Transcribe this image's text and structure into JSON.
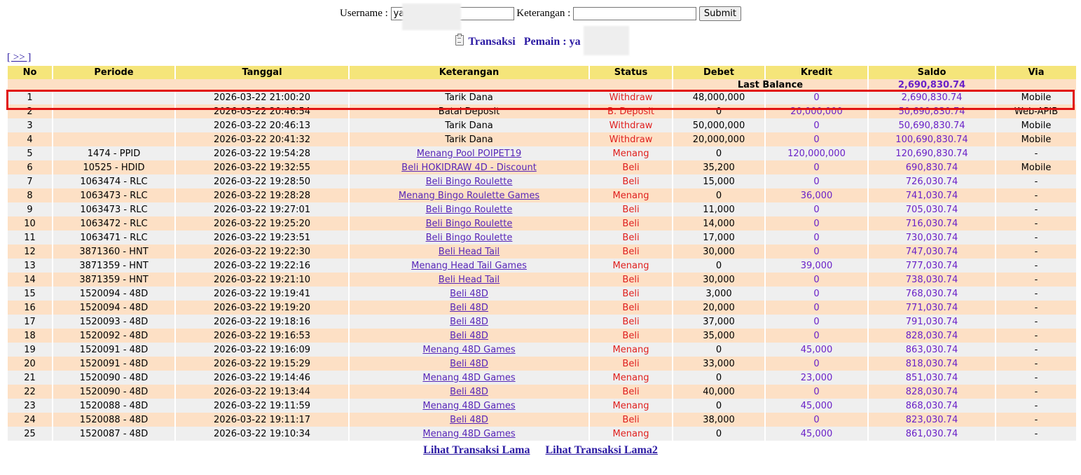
{
  "search": {
    "username_label": "Username :",
    "username_value": "ya",
    "keterangan_label": "Keterangan :",
    "keterangan_value": "",
    "submit_label": "Submit"
  },
  "heading": {
    "title": "Transaksi",
    "player_label": "Pemain : ya"
  },
  "nav": {
    "next_label": "[ >> ]"
  },
  "table": {
    "headers": [
      "No",
      "Periode",
      "Tanggal",
      "Keterangan",
      "Status",
      "Debet",
      "Kredit",
      "Saldo",
      "Via"
    ],
    "last_balance_label": "Last Balance",
    "last_balance_value": "2,690,830.74",
    "rows": [
      {
        "no": "1",
        "periode": "",
        "tanggal": "2026-03-22 21:00:20",
        "keterangan": "Tarik Dana",
        "link": false,
        "status": "Withdraw",
        "debet": "48,000,000",
        "kredit": "0",
        "saldo": "2,690,830.74",
        "via": "Mobile"
      },
      {
        "no": "2",
        "periode": "",
        "tanggal": "2026-03-22 20:46:54",
        "keterangan": "Batal Deposit",
        "link": false,
        "status": "B. Deposit",
        "debet": "0",
        "kredit": "20,000,000",
        "saldo": "50,690,830.74",
        "via": "Web-APIB"
      },
      {
        "no": "3",
        "periode": "",
        "tanggal": "2026-03-22 20:46:13",
        "keterangan": "Tarik Dana",
        "link": false,
        "status": "Withdraw",
        "debet": "50,000,000",
        "kredit": "0",
        "saldo": "50,690,830.74",
        "via": "Mobile"
      },
      {
        "no": "4",
        "periode": "",
        "tanggal": "2026-03-22 20:41:32",
        "keterangan": "Tarik Dana",
        "link": false,
        "status": "Withdraw",
        "debet": "20,000,000",
        "kredit": "0",
        "saldo": "100,690,830.74",
        "via": "Mobile"
      },
      {
        "no": "5",
        "periode": "1474 - PPID",
        "tanggal": "2026-03-22 19:54:28",
        "keterangan": "Menang Pool POIPET19",
        "link": true,
        "status": "Menang",
        "debet": "0",
        "kredit": "120,000,000",
        "saldo": "120,690,830.74",
        "via": "-"
      },
      {
        "no": "6",
        "periode": "10525 - HDID",
        "tanggal": "2026-03-22 19:32:55",
        "keterangan": "Beli HOKIDRAW 4D - Discount",
        "link": true,
        "status": "Beli",
        "debet": "35,200",
        "kredit": "0",
        "saldo": "690,830.74",
        "via": "Mobile"
      },
      {
        "no": "7",
        "periode": "1063474 - RLC",
        "tanggal": "2026-03-22 19:28:50",
        "keterangan": "Beli Bingo Roulette",
        "link": true,
        "status": "Beli",
        "debet": "15,000",
        "kredit": "0",
        "saldo": "726,030.74",
        "via": "-"
      },
      {
        "no": "8",
        "periode": "1063473 - RLC",
        "tanggal": "2026-03-22 19:28:28",
        "keterangan": "Menang Bingo Roulette Games",
        "link": true,
        "status": "Menang",
        "debet": "0",
        "kredit": "36,000",
        "saldo": "741,030.74",
        "via": "-"
      },
      {
        "no": "9",
        "periode": "1063473 - RLC",
        "tanggal": "2026-03-22 19:27:01",
        "keterangan": "Beli Bingo Roulette",
        "link": true,
        "status": "Beli",
        "debet": "11,000",
        "kredit": "0",
        "saldo": "705,030.74",
        "via": "-"
      },
      {
        "no": "10",
        "periode": "1063472 - RLC",
        "tanggal": "2026-03-22 19:25:20",
        "keterangan": "Beli Bingo Roulette",
        "link": true,
        "status": "Beli",
        "debet": "14,000",
        "kredit": "0",
        "saldo": "716,030.74",
        "via": "-"
      },
      {
        "no": "11",
        "periode": "1063471 - RLC",
        "tanggal": "2026-03-22 19:23:51",
        "keterangan": "Beli Bingo Roulette",
        "link": true,
        "status": "Beli",
        "debet": "17,000",
        "kredit": "0",
        "saldo": "730,030.74",
        "via": "-"
      },
      {
        "no": "12",
        "periode": "3871360 - HNT",
        "tanggal": "2026-03-22 19:22:30",
        "keterangan": "Beli Head Tail",
        "link": true,
        "status": "Beli",
        "debet": "30,000",
        "kredit": "0",
        "saldo": "747,030.74",
        "via": "-"
      },
      {
        "no": "13",
        "periode": "3871359 - HNT",
        "tanggal": "2026-03-22 19:22:16",
        "keterangan": "Menang Head Tail Games",
        "link": true,
        "status": "Menang",
        "debet": "0",
        "kredit": "39,000",
        "saldo": "777,030.74",
        "via": "-"
      },
      {
        "no": "14",
        "periode": "3871359 - HNT",
        "tanggal": "2026-03-22 19:21:10",
        "keterangan": "Beli Head Tail",
        "link": true,
        "status": "Beli",
        "debet": "30,000",
        "kredit": "0",
        "saldo": "738,030.74",
        "via": "-"
      },
      {
        "no": "15",
        "periode": "1520094 - 48D",
        "tanggal": "2026-03-22 19:19:41",
        "keterangan": "Beli 48D",
        "link": true,
        "status": "Beli",
        "debet": "3,000",
        "kredit": "0",
        "saldo": "768,030.74",
        "via": "-"
      },
      {
        "no": "16",
        "periode": "1520094 - 48D",
        "tanggal": "2026-03-22 19:19:20",
        "keterangan": "Beli 48D",
        "link": true,
        "status": "Beli",
        "debet": "20,000",
        "kredit": "0",
        "saldo": "771,030.74",
        "via": "-"
      },
      {
        "no": "17",
        "periode": "1520093 - 48D",
        "tanggal": "2026-03-22 19:18:16",
        "keterangan": "Beli 48D",
        "link": true,
        "status": "Beli",
        "debet": "37,000",
        "kredit": "0",
        "saldo": "791,030.74",
        "via": "-"
      },
      {
        "no": "18",
        "periode": "1520092 - 48D",
        "tanggal": "2026-03-22 19:16:53",
        "keterangan": "Beli 48D",
        "link": true,
        "status": "Beli",
        "debet": "35,000",
        "kredit": "0",
        "saldo": "828,030.74",
        "via": "-"
      },
      {
        "no": "19",
        "periode": "1520091 - 48D",
        "tanggal": "2026-03-22 19:16:09",
        "keterangan": "Menang 48D Games",
        "link": true,
        "status": "Menang",
        "debet": "0",
        "kredit": "45,000",
        "saldo": "863,030.74",
        "via": "-"
      },
      {
        "no": "20",
        "periode": "1520091 - 48D",
        "tanggal": "2026-03-22 19:15:29",
        "keterangan": "Beli 48D",
        "link": true,
        "status": "Beli",
        "debet": "33,000",
        "kredit": "0",
        "saldo": "818,030.74",
        "via": "-"
      },
      {
        "no": "21",
        "periode": "1520090 - 48D",
        "tanggal": "2026-03-22 19:14:46",
        "keterangan": "Menang 48D Games",
        "link": true,
        "status": "Menang",
        "debet": "0",
        "kredit": "23,000",
        "saldo": "851,030.74",
        "via": "-"
      },
      {
        "no": "22",
        "periode": "1520090 - 48D",
        "tanggal": "2026-03-22 19:13:44",
        "keterangan": "Beli 48D",
        "link": true,
        "status": "Beli",
        "debet": "40,000",
        "kredit": "0",
        "saldo": "828,030.74",
        "via": "-"
      },
      {
        "no": "23",
        "periode": "1520088 - 48D",
        "tanggal": "2026-03-22 19:11:59",
        "keterangan": "Menang 48D Games",
        "link": true,
        "status": "Menang",
        "debet": "0",
        "kredit": "45,000",
        "saldo": "868,030.74",
        "via": "-"
      },
      {
        "no": "24",
        "periode": "1520088 - 48D",
        "tanggal": "2026-03-22 19:11:17",
        "keterangan": "Beli 48D",
        "link": true,
        "status": "Beli",
        "debet": "38,000",
        "kredit": "0",
        "saldo": "823,030.74",
        "via": "-"
      },
      {
        "no": "25",
        "periode": "1520087 - 48D",
        "tanggal": "2026-03-22 19:10:34",
        "keterangan": "Menang 48D Games",
        "link": true,
        "status": "Menang",
        "debet": "0",
        "kredit": "45,000",
        "saldo": "861,030.74",
        "via": "-"
      }
    ]
  },
  "footer": {
    "link1": "Lihat Transaksi Lama",
    "link2": "Lihat Transaksi Lama2"
  },
  "colors": {
    "header_bg": "#f5e57a",
    "row_odd": "#efefef",
    "row_even": "#fde0c5",
    "status": "#e0201e",
    "amount": "#6a22c8",
    "link": "#2b1aa3",
    "highlight": "#e11414"
  },
  "icons": {
    "heading_icon": "clipboard-icon"
  }
}
